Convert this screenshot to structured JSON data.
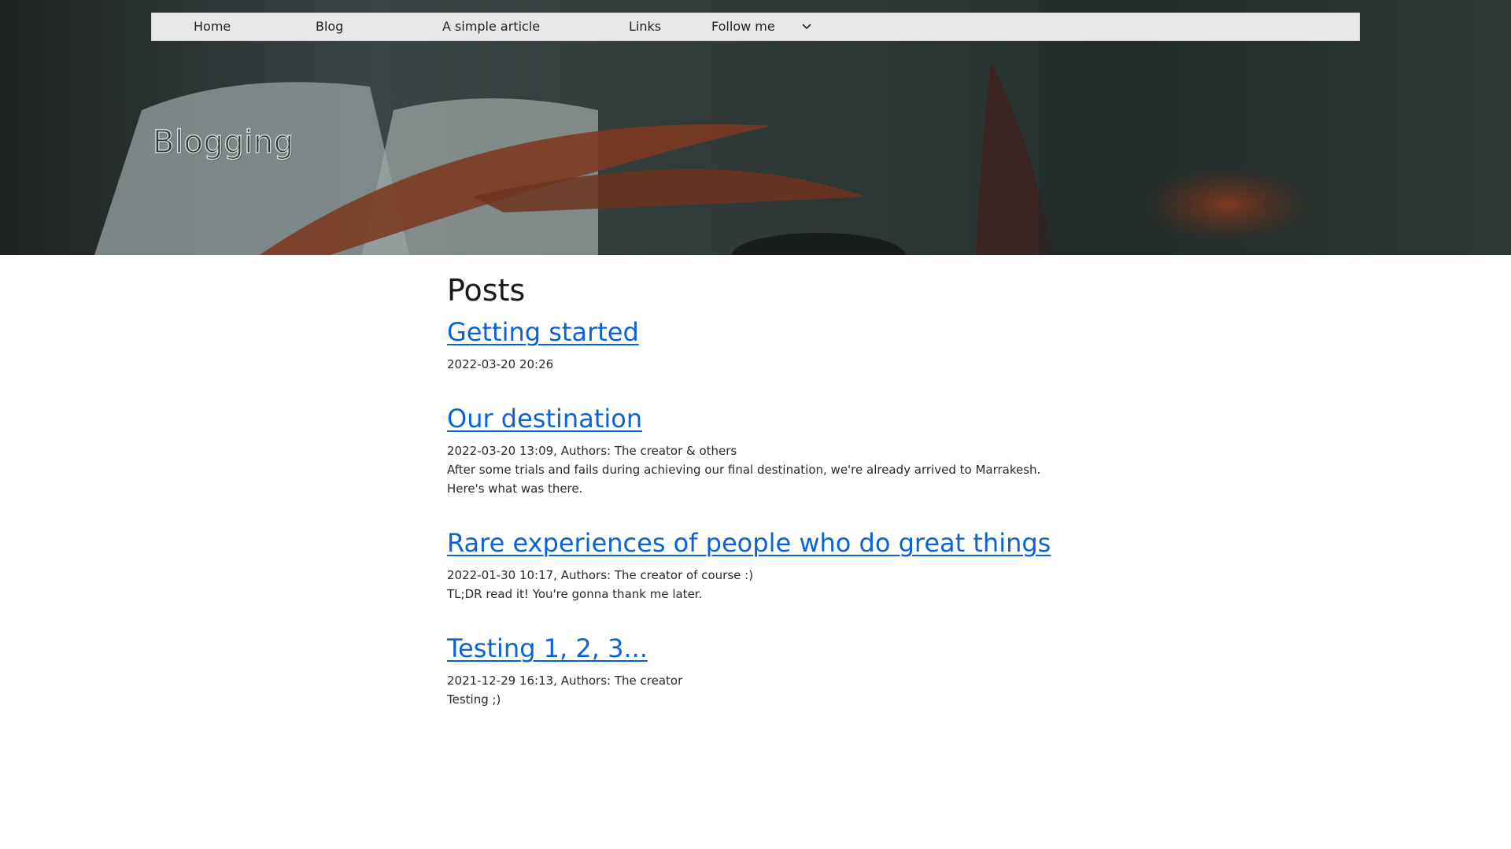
{
  "nav": {
    "items": [
      {
        "label": "Home"
      },
      {
        "label": "Blog"
      },
      {
        "label": "A simple article"
      },
      {
        "label": "Links"
      },
      {
        "label": "Follow me"
      }
    ]
  },
  "hero": {
    "title": "Blogging"
  },
  "main": {
    "heading": "Posts",
    "posts": [
      {
        "title": "Getting started",
        "meta": "2022-03-20 20:26",
        "summary": ""
      },
      {
        "title": "Our destination",
        "meta": "2022-03-20 13:09, Authors: The creator & others",
        "summary": "After some trials and fails during achieving our final destination, we're already arrived to Marrakesh. Here's what was there."
      },
      {
        "title": "Rare experiences of people who do great things",
        "meta": "2022-01-30 10:17, Authors: The creator of course :)",
        "summary": "TL;DR read it! You're gonna thank me later."
      },
      {
        "title": "Testing 1, 2, 3...",
        "meta": "2021-12-29 16:13, Authors: The creator",
        "summary": "Testing ;)"
      }
    ]
  },
  "colors": {
    "link": "#0a63d6",
    "navbar": "#e8e8e8"
  },
  "icons": {
    "dropdown": "chevron-down-icon"
  }
}
